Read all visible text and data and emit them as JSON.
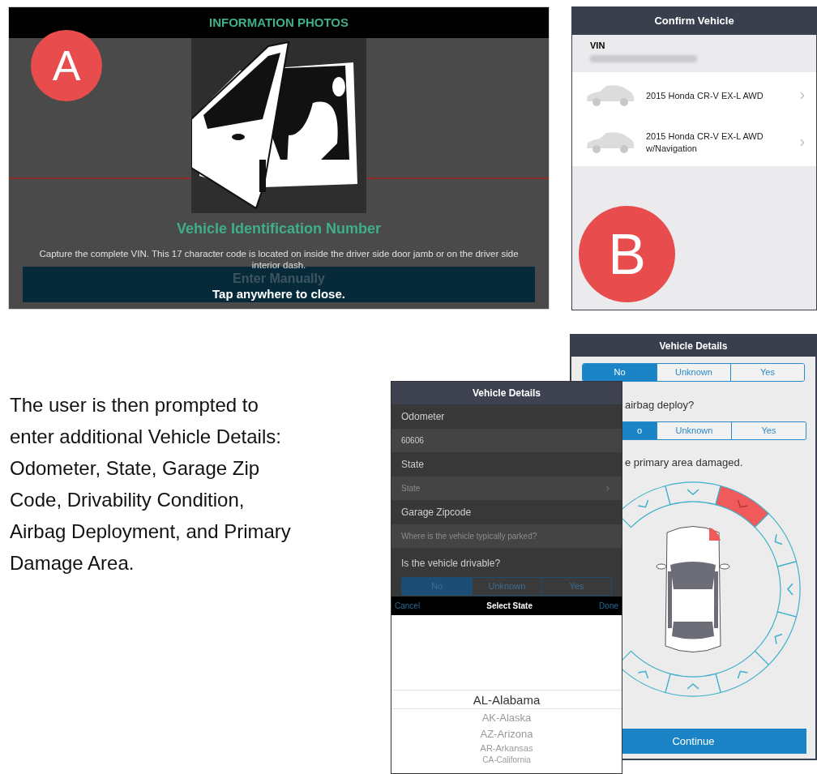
{
  "info_photos": {
    "title": "INFORMATION PHOTOS",
    "badge": "A",
    "heading": "Vehicle Identification Number",
    "description": "Capture the complete VIN. This 17 character code is located on inside the driver side door jamb or on the driver side interior dash.",
    "enter_manually": "Enter Manually",
    "close_hint": "Tap anywhere to close."
  },
  "confirm_vehicle": {
    "title": "Confirm Vehicle",
    "badge": "B",
    "vin_label": "VIN",
    "vehicles": [
      {
        "name": "2015 Honda CR-V EX-L AWD"
      },
      {
        "name": "2015 Honda CR-V EX-L AWD w/Navigation"
      }
    ]
  },
  "intro_lines": [
    "The user is then prompted to",
    "enter additional Vehicle Details:",
    "Odometer, State, Garage Zip",
    "Code, Drivability Condition,",
    "Airbag Deployment, and Primary",
    "Damage Area."
  ],
  "vehicle_details_damage": {
    "title": "Vehicle Details",
    "drivable_options": [
      {
        "label": "No",
        "selected": true
      },
      {
        "label": "Unknown",
        "selected": false
      },
      {
        "label": "Yes",
        "selected": false
      }
    ],
    "airbag_question": "airbag deploy?",
    "airbag_options": [
      {
        "label": "o",
        "selected": true
      },
      {
        "label": "Unknown",
        "selected": false
      },
      {
        "label": "Yes",
        "selected": false
      }
    ],
    "damage_prompt": "e primary area damaged.",
    "damage_areas": [
      {
        "selected": false
      },
      {
        "selected": false
      },
      {
        "selected": true
      },
      {
        "selected": false
      },
      {
        "selected": false
      },
      {
        "selected": false
      },
      {
        "selected": false
      },
      {
        "selected": false
      },
      {
        "selected": false
      }
    ],
    "continue": "Continue"
  },
  "vehicle_details_form": {
    "title": "Vehicle Details",
    "fields": [
      {
        "label": "Odometer",
        "value": "60606"
      },
      {
        "label": "State",
        "placeholder": "State",
        "chevron": true
      },
      {
        "label": "Garage Zipcode",
        "placeholder": "Where is the vehicle typically parked?"
      }
    ],
    "drivable_question": "Is the vehicle drivable?",
    "drivable_options": [
      {
        "label": "No",
        "selected": true
      },
      {
        "label": "Unknown",
        "selected": false
      },
      {
        "label": "Yes",
        "selected": false
      }
    ],
    "picker": {
      "cancel": "Cancel",
      "title": "Select State",
      "done": "Done",
      "items": [
        {
          "label": "AL-Alabama",
          "selected": true
        },
        {
          "label": "AK-Alaska",
          "selected": false
        },
        {
          "label": "AZ-Arizona",
          "selected": false
        },
        {
          "label": "AR-Arkansas",
          "selected": false
        },
        {
          "label": "CA-California",
          "selected": false
        }
      ]
    }
  }
}
